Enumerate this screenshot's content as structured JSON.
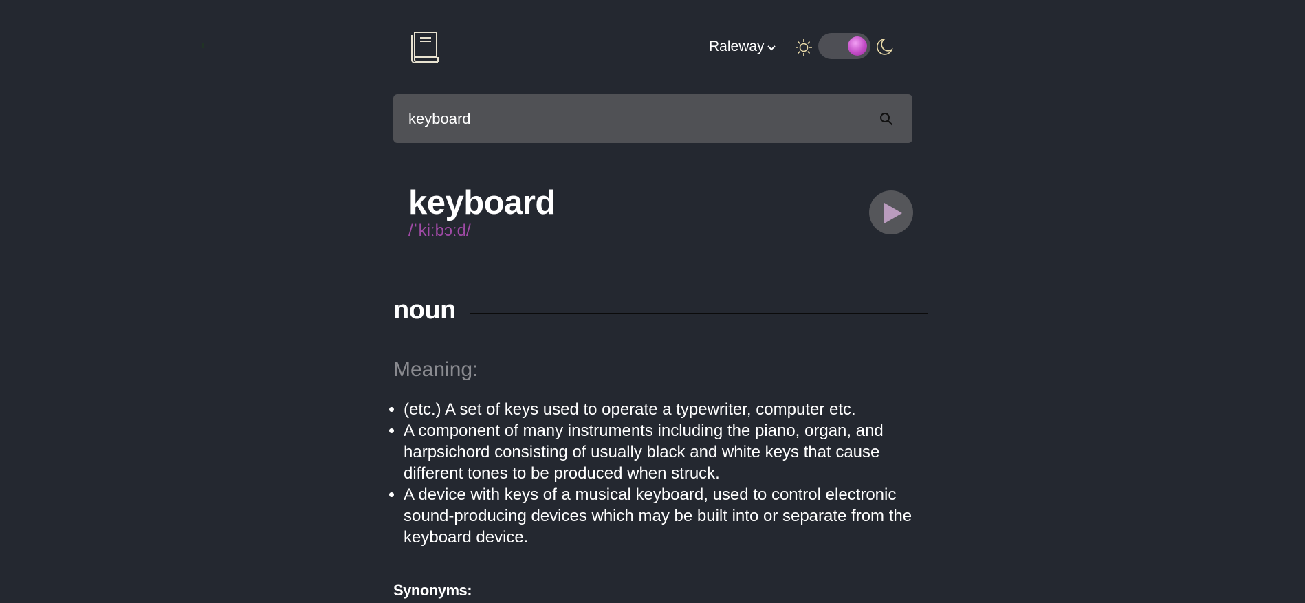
{
  "header": {
    "font_selector": "Raleway",
    "theme": "dark"
  },
  "search": {
    "value": "keyboard"
  },
  "entry": {
    "word": "keyboard",
    "phonetic": "/ˈkiːbɔːd/",
    "part_of_speech": "noun",
    "meaning_heading": "Meaning:",
    "definitions": [
      "(etc.) A set of keys used to operate a typewriter, computer etc.",
      "A component of many instruments including the piano, organ, and harpsichord consisting of usually black and white keys that cause different tones to be produced when struck.",
      "A device with keys of a musical keyboard, used to control electronic sound-producing devices which may be built into or separate from the keyboard device."
    ],
    "synonyms_label": "Synonyms:"
  },
  "colors": {
    "background": "#242830",
    "search_bg": "#505155",
    "accent": "#a04aa6",
    "muted_heading": "#8a8b90"
  },
  "icons": [
    "book-logo-icon",
    "chevron-down-icon",
    "sun-icon",
    "moon-icon",
    "search-icon",
    "play-icon"
  ]
}
